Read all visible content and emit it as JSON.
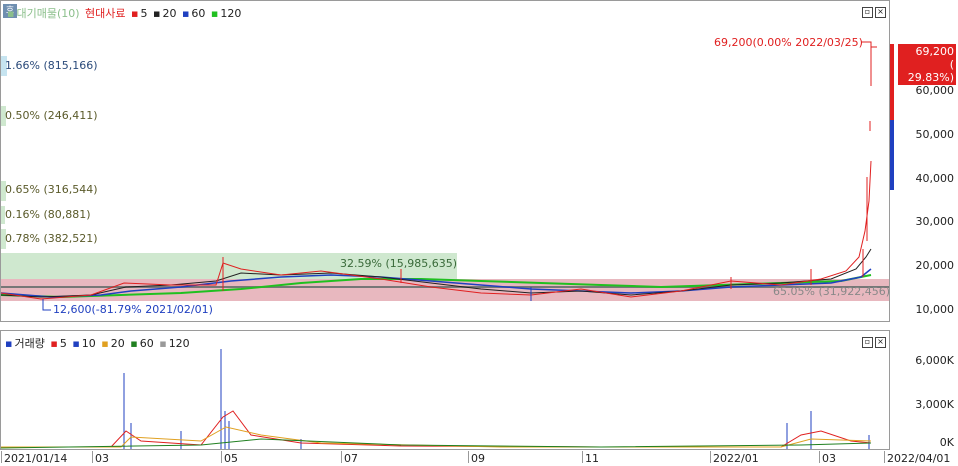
{
  "price_panel": {
    "legend": {
      "square_icon": "▪",
      "series_main": "대기매물(10)",
      "stock_name": "현대사료",
      "ma5": "5",
      "ma20": "20",
      "ma60": "60",
      "ma120": "120"
    },
    "left_icon": "호",
    "left_labels": [
      "1.66% (815,166)",
      "0.50% (246,411)",
      "0.65% (316,544)",
      "0.16% (80,881)",
      "0.78% (382,521)"
    ],
    "max_annotation": "69,200(0.00% 2022/03/25)",
    "min_annotation": "12,600(-81.79% 2021/02/01)",
    "green_zone_label": "32.59% (15,985,635)",
    "pink_zone_label": "65.05% (31,922,456)",
    "price_tag": {
      "price": "69,200",
      "change": "( 29.83%)"
    },
    "y_ticks": [
      "60,000",
      "50,000",
      "40,000",
      "30,000",
      "20,000",
      "10,000"
    ]
  },
  "volume_panel": {
    "legend": {
      "volume": "거래량",
      "ma5": "5",
      "ma10": "10",
      "ma20": "20",
      "ma60": "60",
      "ma120": "120"
    },
    "y_ticks": [
      "6,000K",
      "3,000K",
      "0K"
    ]
  },
  "x_axis": [
    "2021/01/14",
    "03",
    "05",
    "07",
    "09",
    "11",
    "2022/01",
    "03",
    "2022/04/01"
  ],
  "colors": {
    "ma5": "#e02020",
    "ma20": "#222222",
    "ma60": "#2040c0",
    "ma120": "#20c020",
    "up": "#e02020",
    "down": "#2040c0"
  }
}
